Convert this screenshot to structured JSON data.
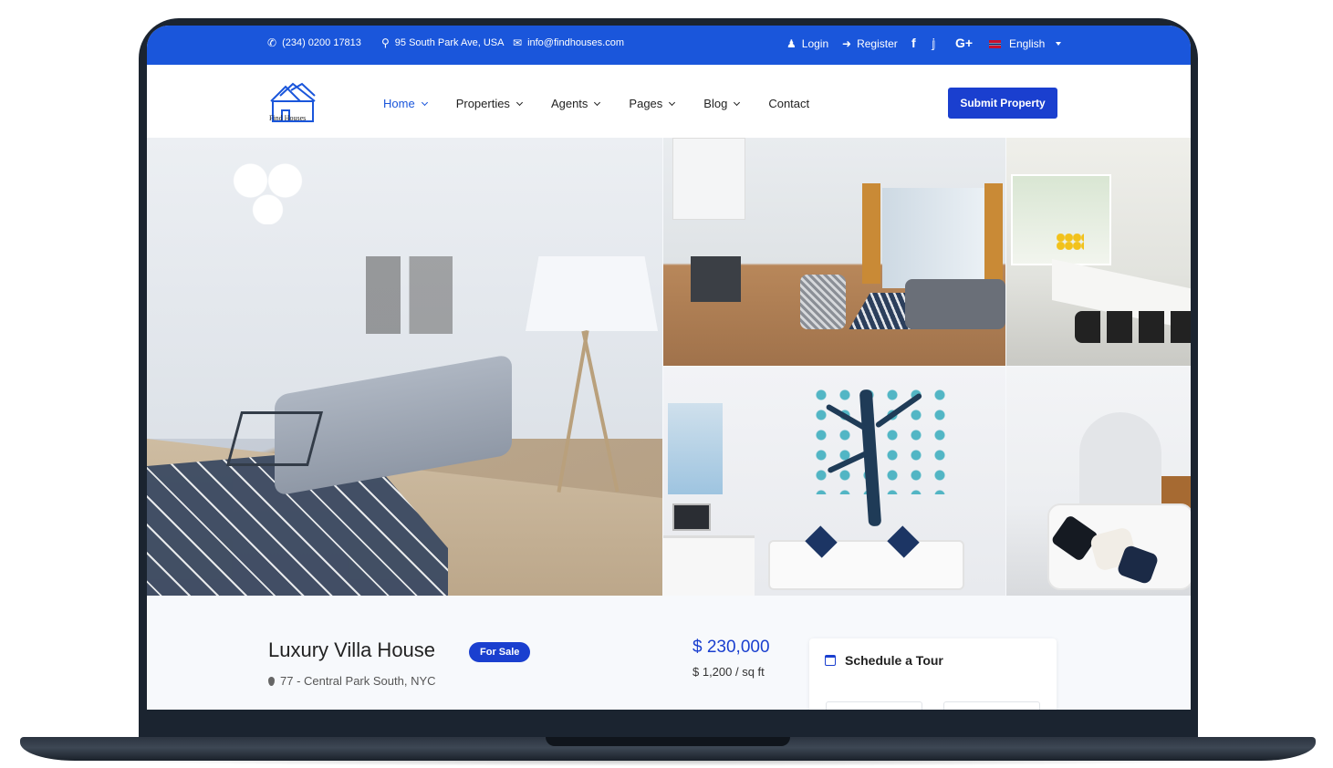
{
  "topbar": {
    "phone": "(234) 0200 17813",
    "address": "95 South Park Ave, USA",
    "email": "info@findhouses.com",
    "login": "Login",
    "register": "Register",
    "language": "English",
    "phone_icon": "phone-icon",
    "address_icon": "map-pin-icon",
    "email_icon": "envelope-icon",
    "login_icon": "user-icon",
    "register_icon": "sign-in-icon",
    "social": [
      "facebook-icon",
      "twitter-icon",
      "google-plus-icon"
    ]
  },
  "navbar": {
    "logo_text": "Find Houses",
    "items": [
      {
        "label": "Home",
        "active": true,
        "dropdown": true
      },
      {
        "label": "Properties",
        "active": false,
        "dropdown": true
      },
      {
        "label": "Agents",
        "active": false,
        "dropdown": true
      },
      {
        "label": "Pages",
        "active": false,
        "dropdown": true
      },
      {
        "label": "Blog",
        "active": false,
        "dropdown": true
      },
      {
        "label": "Contact",
        "active": false,
        "dropdown": false
      }
    ],
    "submit_label": "Submit Property"
  },
  "listing": {
    "title": "Luxury Villa House",
    "badge": "For Sale",
    "address": "77 - Central Park South, NYC",
    "price": "$ 230,000",
    "price_per_sqft": "$ 1,200 / sq ft",
    "schedule_title": "Schedule a Tour"
  },
  "colors": {
    "accent": "#1a56db",
    "button": "#1a3fcf"
  }
}
